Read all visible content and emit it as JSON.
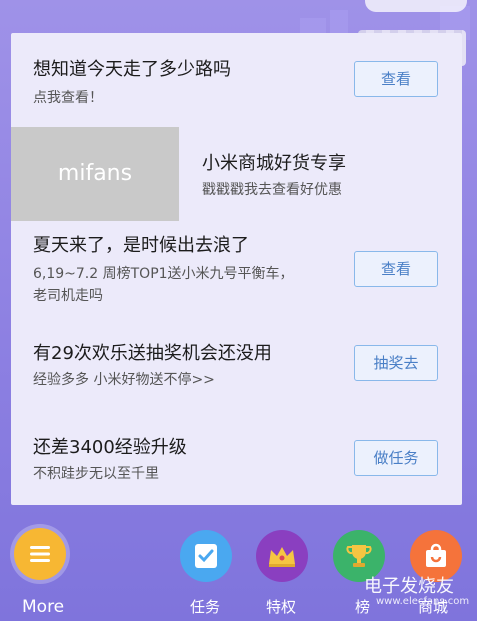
{
  "cards": [
    {
      "title": "想知道今天走了多少路吗",
      "subtitle": "点我查看！",
      "button": "查看"
    },
    {
      "title": "小米商城好货专享",
      "subtitle": "戳戳戳我去查看好优惠",
      "image_text": "mifans"
    },
    {
      "title": "夏天来了，是时候出去浪了",
      "subtitle_line1": "6,19~7.2 周榜TOP1送小米九号平衡车，",
      "subtitle_line2": "老司机走吗",
      "button": "查看"
    },
    {
      "title": "有29次欢乐送抽奖机会还没用",
      "subtitle": "经验多多 小米好物送不停>>",
      "button": "抽奖去"
    },
    {
      "title": "还差3400经验升级",
      "subtitle": "不积跬步无以至千里",
      "button": "做任务"
    }
  ],
  "bottom_nav": {
    "more_label": "More",
    "tasks_label": "任务",
    "privileges_label": "特权",
    "rank_label": "榜",
    "mall_label": "商城"
  },
  "watermark": {
    "cn": "电子发烧友",
    "en": "www.elecfans.com"
  },
  "colors": {
    "background": "#8d80e2",
    "panel": "#eceafa",
    "button_border": "#89b8ea",
    "button_text": "#4a7fc6",
    "more_circle": "#f7b733"
  }
}
